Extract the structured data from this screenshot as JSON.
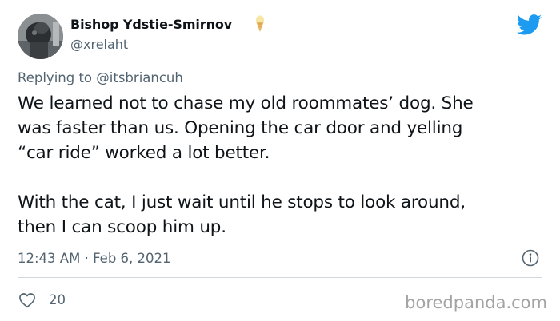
{
  "tweet": {
    "author_name": "Bishop Ydstie-Smirnov",
    "author_handle": "@xrelaht",
    "badge_icon": "ice-cream-icon",
    "reply_prefix": "Replying to",
    "reply_to": "@itsbriancuh",
    "text_lines": [
      "We learned not to chase my old roommates’ dog. She",
      "was faster than us. Opening the car door and yelling",
      "“car ride” worked a lot better.",
      "With the cat, I just wait until he stops to look around,",
      "then I can scoop him up."
    ],
    "time": "12:43 AM",
    "separator": "·",
    "date": "Feb 6, 2021",
    "like_count": "20"
  },
  "watermark": "boredpanda.com",
  "colors": {
    "twitter_blue": "#1d9bf0",
    "text": "#0f1419",
    "muted": "#536471",
    "divider": "#cfd9de"
  },
  "icons": {
    "brand": "twitter-bird-icon",
    "info": "info-icon",
    "like": "heart-icon"
  }
}
